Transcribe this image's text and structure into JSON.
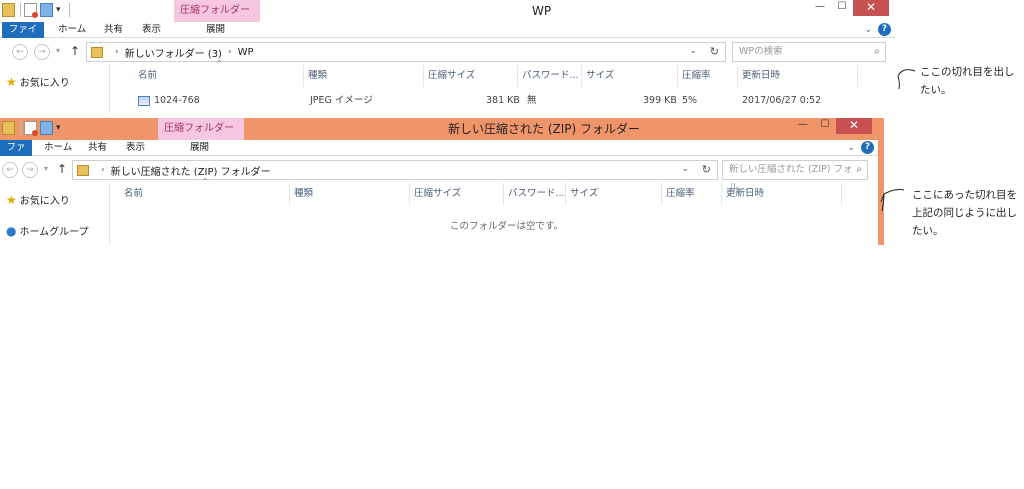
{
  "window1": {
    "title": "WP",
    "context_tab": "圧縮フォルダー ツール",
    "ribbon_tabs": [
      "ファイル",
      "ホーム",
      "共有",
      "表示",
      "展開"
    ],
    "address_path": [
      "新しいフォルダー (3)",
      "WP"
    ],
    "search_placeholder": "WPの検索",
    "sidebar_favorites": "お気に入り",
    "columns": [
      "名前",
      "種類",
      "圧縮サイズ",
      "パスワード...",
      "サイズ",
      "圧縮率",
      "更新日時"
    ],
    "row": {
      "name": "1024-768",
      "type": "JPEG イメージ",
      "compressed_size": "381 KB",
      "password": "無",
      "size": "399 KB",
      "ratio": "5%",
      "modified": "2017/06/27 0:52"
    }
  },
  "window2": {
    "title": "新しい圧縮された (ZIP) フォルダー",
    "context_tab": "圧縮フォルダー ツール",
    "ribbon_tabs": [
      "ファイル",
      "ホーム",
      "共有",
      "表示",
      "展開"
    ],
    "address_path": [
      "新しい圧縮された (ZIP) フォルダー"
    ],
    "search_placeholder": "新しい圧縮された (ZIP) フォル...",
    "sidebar_favorites": "お気に入り",
    "sidebar_homegroup": "ホームグループ",
    "columns": [
      "名前",
      "種類",
      "圧縮サイズ",
      "パスワード...",
      "サイズ",
      "圧縮率",
      "更新日時"
    ],
    "empty_message": "このフォルダーは空です。"
  },
  "notes": {
    "note1": [
      "ここの切れ目を出し",
      "たい。"
    ],
    "note2": [
      "ここにあった切れ目を",
      "上記の同じように出し",
      "たい。"
    ]
  },
  "colors": {
    "accent_blue": "#1e6ebd",
    "zip_titlebar": "#f0956a",
    "context_tab_bg": "#f7c7e1",
    "close_button": "#c75050"
  },
  "icons": [
    "folder-icon",
    "properties-icon",
    "new-folder-icon",
    "back-icon",
    "forward-icon",
    "up-icon",
    "refresh-icon",
    "search-icon",
    "star-icon",
    "homegroup-icon",
    "help-icon",
    "image-file-icon"
  ]
}
